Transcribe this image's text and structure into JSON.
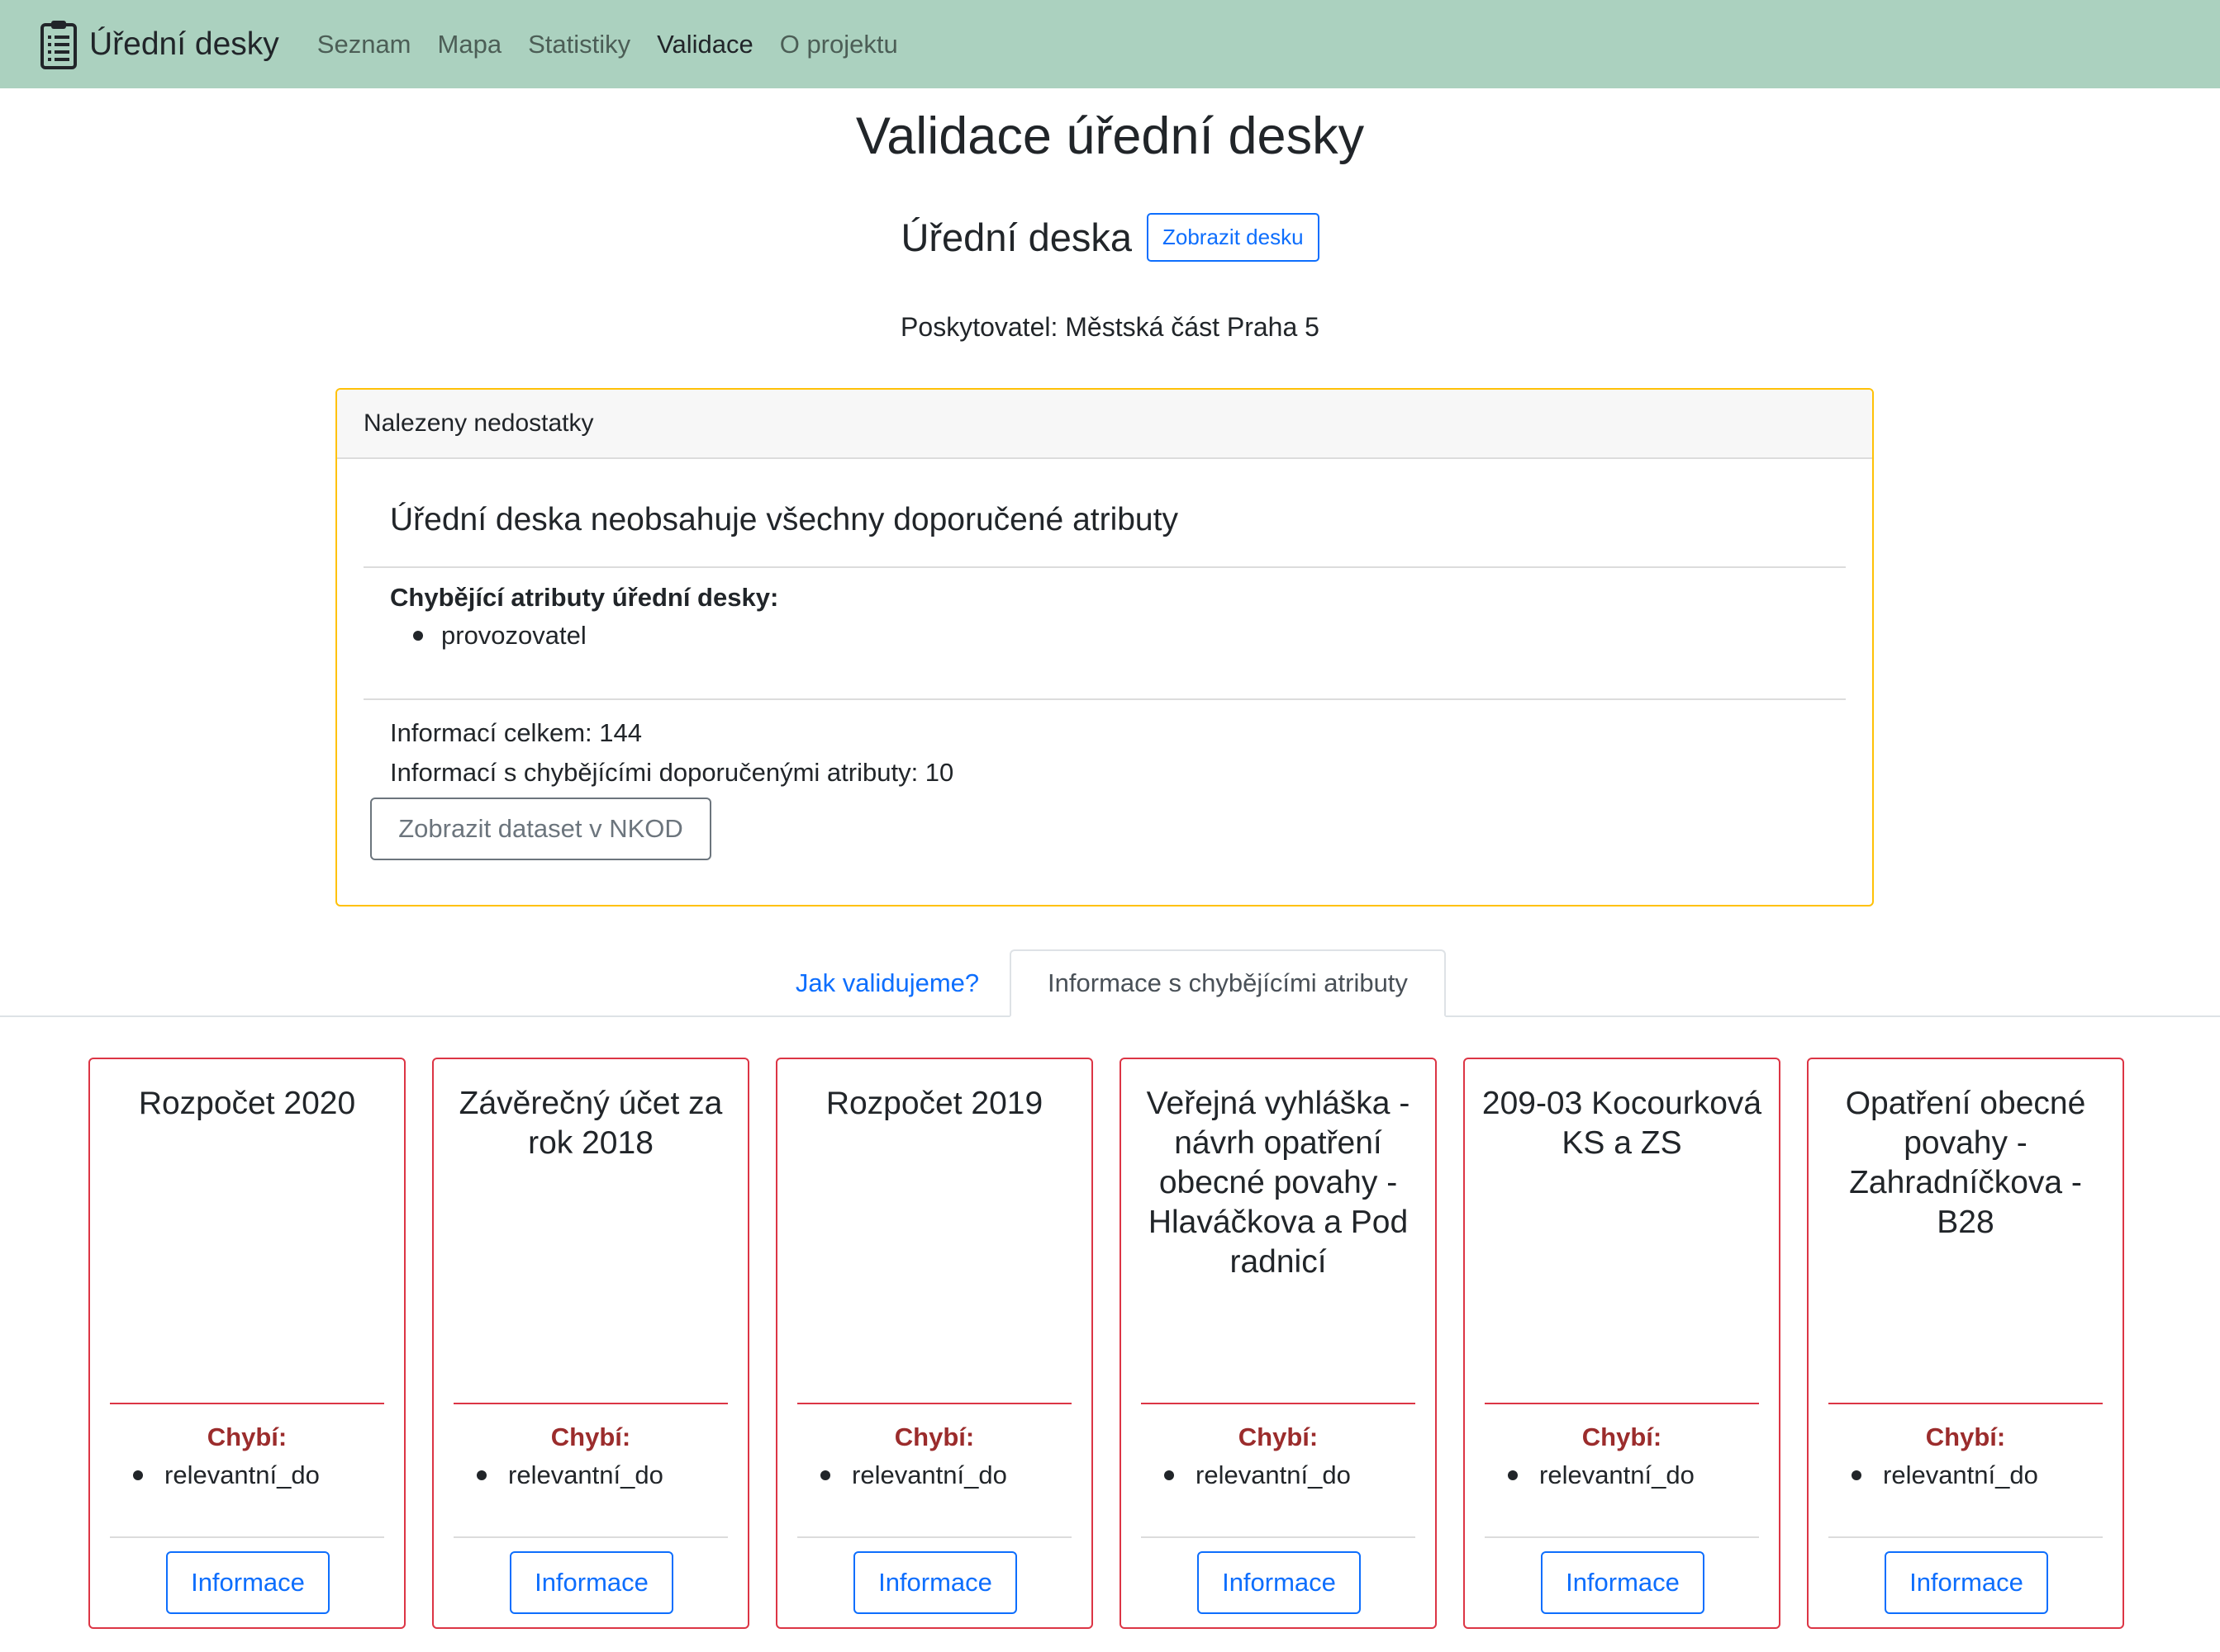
{
  "navbar": {
    "brand": "Úřední desky",
    "brand_icon": "clipboard-list-icon",
    "links": [
      "Seznam",
      "Mapa",
      "Statistiky",
      "Validace",
      "O projektu"
    ],
    "active": "Validace"
  },
  "page": {
    "title": "Validace úřední desky",
    "board_title": "Úřední deska",
    "show_board_button": "Zobrazit desku",
    "provider": "Poskytovatel: Městská část Praha 5"
  },
  "warning": {
    "header": "Nalezeny nedostatky",
    "heading": "Úřední deska neobsahuje všechny doporučené atributy",
    "missing_label": "Chybějící atributy úřední desky:",
    "missing_items": [
      "provozovatel"
    ],
    "total_info": "Informací celkem: 144",
    "missing_info": "Informací s chybějícími doporučenými atributy: 10",
    "nkod_button": "Zobrazit dataset v NKOD",
    "border_color": "#ffc107"
  },
  "tabs": {
    "how": "Jak validujeme?",
    "active": "Informace s chybějícími atributy"
  },
  "cards": [
    {
      "title": "Rozpočet 2020",
      "missing_label": "Chybí:",
      "missing": "relevantní_do",
      "button": "Informace"
    },
    {
      "title": "Závěrečný účet za rok 2018",
      "missing_label": "Chybí:",
      "missing": "relevantní_do",
      "button": "Informace"
    },
    {
      "title": "Rozpočet 2019",
      "missing_label": "Chybí:",
      "missing": "relevantní_do",
      "button": "Informace"
    },
    {
      "title": "Veřejná vyhláška - návrh opatření obecné povahy - Hlaváčkova a Pod radnicí",
      "missing_label": "Chybí:",
      "missing": "relevantní_do",
      "button": "Informace"
    },
    {
      "title": "209-03 Kocourková KS a ZS",
      "missing_label": "Chybí:",
      "missing": "relevantní_do",
      "button": "Informace"
    },
    {
      "title": "Opatření obecné povahy - Zahradníčkova - B28",
      "missing_label": "Chybí:",
      "missing": "relevantní_do",
      "button": "Informace"
    }
  ],
  "colors": {
    "navbar_bg": "#abd1bf",
    "primary": "#0d6efd",
    "danger": "#dc3545",
    "warning": "#ffc107"
  }
}
